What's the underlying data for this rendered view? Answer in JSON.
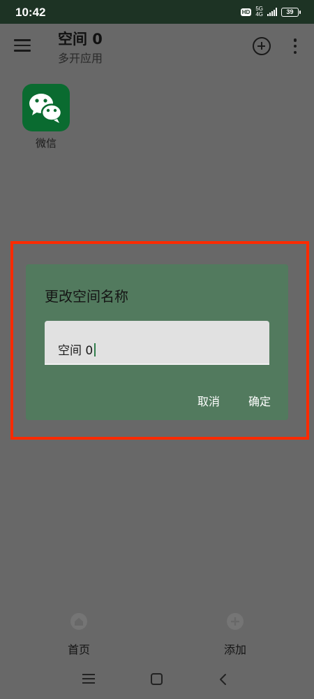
{
  "status_bar": {
    "time": "10:42",
    "hd_badge": "HD",
    "network_top": "5G",
    "network_bottom": "4G",
    "battery": "39"
  },
  "app_bar": {
    "title": "空间 0",
    "subtitle": "多开应用",
    "icons": [
      "menu-icon",
      "add-circle-icon",
      "more-vert-icon"
    ]
  },
  "apps": [
    {
      "label": "微信",
      "icon": "wechat-icon",
      "color": "#0a6b30"
    }
  ],
  "dialog": {
    "title": "更改空间名称",
    "input_value": "空间 0",
    "cancel_label": "取消",
    "ok_label": "确定"
  },
  "bottom_nav": {
    "home_label": "首页",
    "add_label": "添加"
  },
  "colors": {
    "scrim": "#686868",
    "status_bar": "#1d3324",
    "dialog_bg": "#527a5e",
    "highlight": "#ff2a00",
    "app_icon": "#0a6b30"
  }
}
